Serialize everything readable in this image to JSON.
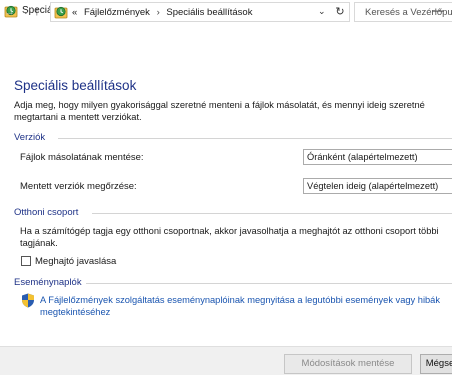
{
  "window": {
    "title": "Speciális beállítások",
    "minimize_label": "—"
  },
  "address_bar": {
    "crumbs": [
      "Fájlelőzmények",
      "Speciális beállítások"
    ],
    "prefix": "«",
    "separator": "›",
    "search_placeholder": "Keresés a Vezérlőpultban"
  },
  "page": {
    "title": "Speciális beállítások",
    "intro": "Adja meg, hogy milyen gyakorisággal szeretné menteni a fájlok másolatát, és mennyi ideig szeretné megtartani a mentett verziókat."
  },
  "versions": {
    "heading": "Verziók",
    "save_copies_label": "Fájlok másolatának mentése:",
    "save_copies_value": "Óránként (alapértelmezett)",
    "keep_versions_label": "Mentett verziók megőrzése:",
    "keep_versions_value": "Végtelen ideig (alapértelmezett)"
  },
  "homegroup": {
    "heading": "Otthoni csoport",
    "description": "Ha a számítógép tagja egy otthoni csoportnak, akkor javasolhatja a meghajtót az otthoni csoport többi tagjának.",
    "checkbox_label": "Meghajtó javaslása",
    "checkbox_checked": false
  },
  "eventlog": {
    "heading": "Eseménynaplók",
    "link_text": "A Fájlelőzmények szolgáltatás eseménynaplóinak megnyitása a legutóbbi események vagy hibák megtekintéséhez"
  },
  "footer": {
    "save_button": "Módosítások mentése",
    "cancel_button": "Mégse"
  },
  "colors": {
    "heading_blue": "#1e3287",
    "link_blue": "#1a55b0",
    "footer_bg": "#f0f0f0"
  }
}
